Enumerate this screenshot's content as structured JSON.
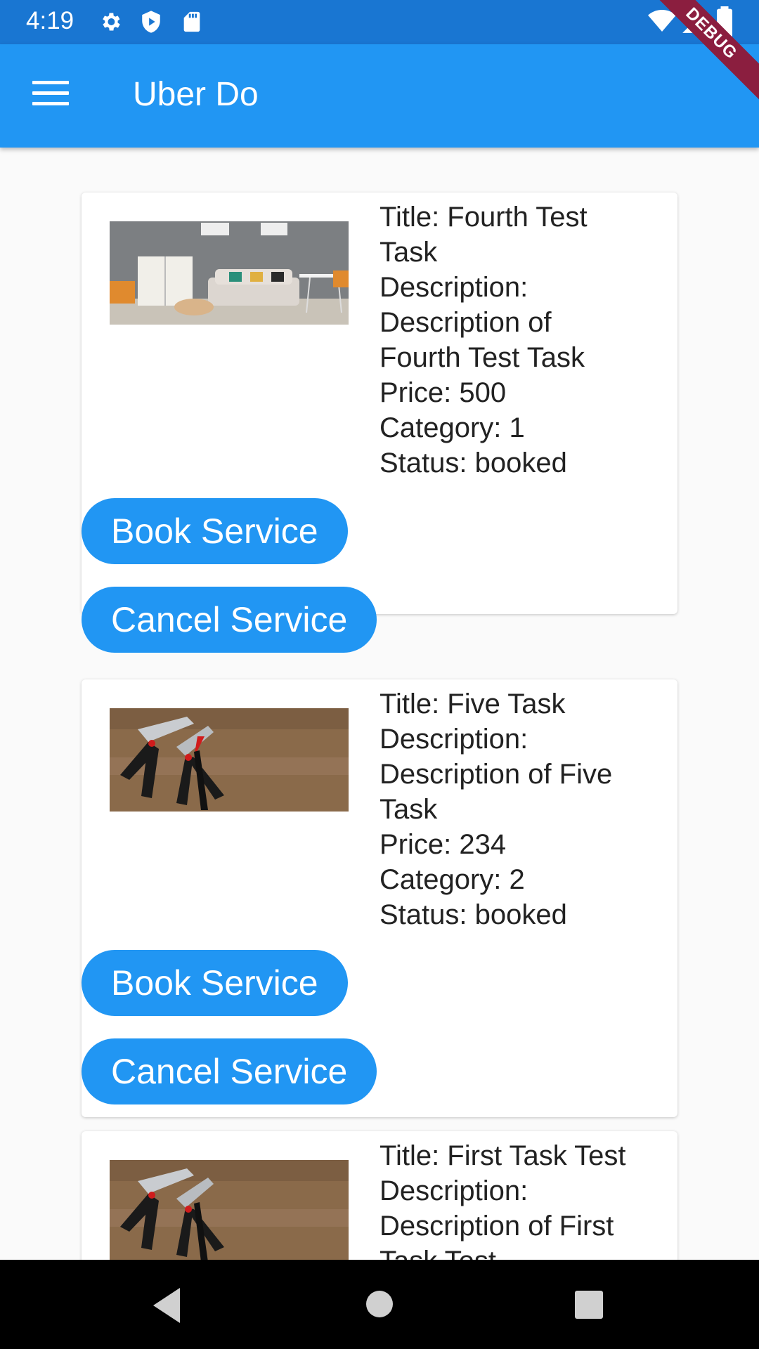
{
  "status_bar": {
    "time": "4:19",
    "icons": [
      "settings-icon",
      "shield-icon",
      "sd-card-icon",
      "wifi-icon",
      "cell-signal-icon",
      "battery-icon"
    ]
  },
  "debug_banner": "DEBUG",
  "app_bar": {
    "title": "Uber Do",
    "menu_icon": "hamburger-menu-icon"
  },
  "colors": {
    "primary": "#2196f3",
    "status_bar": "#1976d2",
    "debug": "#8b1e3f"
  },
  "tasks": [
    {
      "image": "living-room-photo",
      "title_line1": "Title: Fourth Test",
      "title_line2": "Task",
      "desc_label": "Description:",
      "desc_line1": "Description of",
      "desc_line2": "Fourth Test Task",
      "price": "Price: 500",
      "category": "Category: 1",
      "status": "Status: booked",
      "book_label": "Book Service",
      "cancel_label": "Cancel Service"
    },
    {
      "image": "pliers-photo",
      "title_line1": "Title: Five Task",
      "desc_label": "Description:",
      "desc_line1": "Description of Five",
      "desc_line2": "Task",
      "price": "Price: 234",
      "category": "Category: 2",
      "status": "Status: booked",
      "book_label": "Book Service",
      "cancel_label": "Cancel Service"
    },
    {
      "image": "pliers-photo",
      "title_line1": "Title: First Task Test",
      "desc_label": "Description:",
      "desc_line1": "Description of First",
      "desc_line2": "Task Test"
    }
  ],
  "nav_bar": {
    "buttons": [
      "back-icon",
      "home-icon",
      "recents-icon"
    ]
  }
}
